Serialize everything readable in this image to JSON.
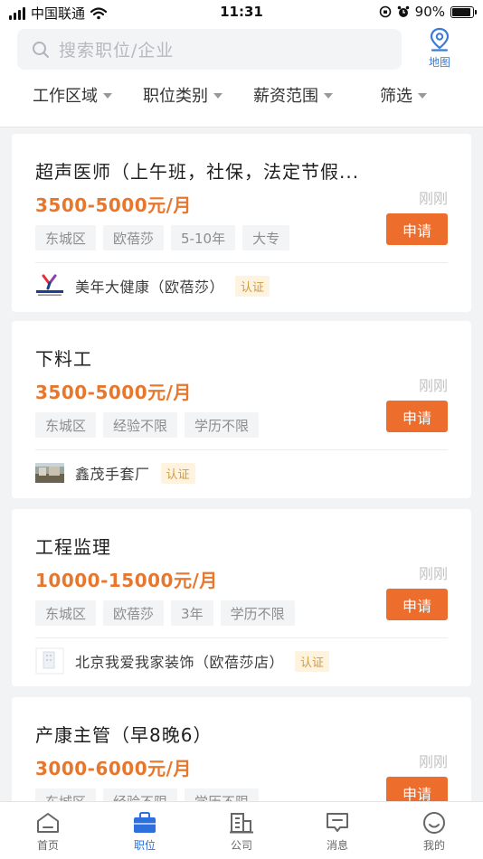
{
  "status_bar": {
    "carrier": "中国联通",
    "time": "11:31",
    "battery": "90%",
    "battery_level": 0.9
  },
  "search": {
    "placeholder": "搜索职位/企业"
  },
  "map": {
    "label": "地图"
  },
  "filters": [
    "工作区域",
    "职位类别",
    "薪资范围",
    "筛选"
  ],
  "jobs": [
    {
      "title": "超声医师（上午班，社保，法定节假...",
      "salary": "3500-5000元/月",
      "posted": "刚刚",
      "apply": "申请",
      "tags": [
        "东城区",
        "欧蓓莎",
        "5-10年",
        "大专"
      ],
      "company": "美年大健康（欧蓓莎）",
      "cert": "认证"
    },
    {
      "title": "下料工",
      "salary": "3500-5000元/月",
      "posted": "刚刚",
      "apply": "申请",
      "tags": [
        "东城区",
        "经验不限",
        "学历不限"
      ],
      "company": "鑫茂手套厂",
      "cert": "认证"
    },
    {
      "title": "工程监理",
      "salary": "10000-15000元/月",
      "posted": "刚刚",
      "apply": "申请",
      "tags": [
        "东城区",
        "欧蓓莎",
        "3年",
        "学历不限"
      ],
      "company": "北京我爱我家装饰（欧蓓莎店）",
      "cert": "认证"
    },
    {
      "title": "产康主管（早8晚6）",
      "salary": "3000-6000元/月",
      "posted": "刚刚",
      "apply": "申请",
      "tags": [
        "东城区",
        "经验不限",
        "学历不限"
      ]
    }
  ],
  "tabbar": {
    "items": [
      {
        "label": "首页",
        "icon": "home-icon"
      },
      {
        "label": "职位",
        "icon": "briefcase-icon",
        "active": true
      },
      {
        "label": "公司",
        "icon": "building-icon"
      },
      {
        "label": "消息",
        "icon": "message-icon"
      },
      {
        "label": "我的",
        "icon": "smile-icon"
      }
    ]
  },
  "colors": {
    "accent": "#ec6d2c",
    "salary": "#e8772e",
    "brand_blue": "#2d6fdc",
    "cert_text": "#d49a3e"
  }
}
